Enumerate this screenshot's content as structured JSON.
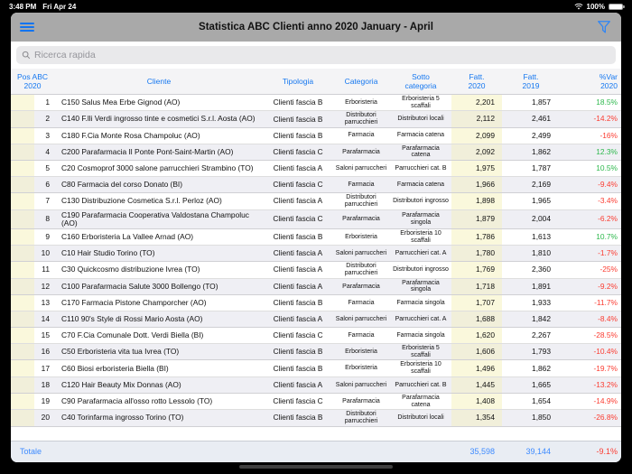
{
  "status_bar": {
    "time": "3:48 PM",
    "date": "Fri Apr 24",
    "battery": "100%"
  },
  "nav_bar": {
    "title": "Statistica ABC Clienti anno 2020 January - April"
  },
  "search": {
    "placeholder": "Ricerca rapida"
  },
  "icons": {
    "menu": "hamburger-menu-icon",
    "filter": "funnel-filter-icon",
    "search": "magnifier-icon",
    "wifi": "wifi-icon",
    "battery": "battery-icon"
  },
  "colors": {
    "accent_blue": "#1577f0",
    "positive_green": "#2db84c",
    "negative_red": "#fb3b30",
    "nav_gray": "#a9a9a9",
    "highlight_yellow": "#faf8dc",
    "row_alt_gray": "#efeff4",
    "totale_bg": "#e9edf3"
  },
  "table": {
    "columns": [
      "Pos ABC\n2020",
      "Cliente",
      "Tipologia",
      "Categoria",
      "Sotto\ncategoria",
      "Fatt.\n2020",
      "Fatt.\n2019",
      "%Var\n2020"
    ],
    "rows": [
      {
        "pos": "1",
        "cliente": "C150 Salus Mea Erbe  Gignod (AO)",
        "tipologia": "Clienti fascia B",
        "categoria": "Erboristeria",
        "sotto": "Erboristeria 5 scaffali",
        "f2020": "2,201",
        "f2019": "1,857",
        "var": "18.5%"
      },
      {
        "pos": "2",
        "cliente": "C140 F.lli Verdi ingrosso tinte e cosmetici S.r.l. Aosta (AO)",
        "tipologia": "Clienti fascia B",
        "categoria": "Distributori parrucchieri",
        "sotto": "Distributori locali",
        "f2020": "2,112",
        "f2019": "2,461",
        "var": "-14.2%"
      },
      {
        "pos": "3",
        "cliente": "C180 F.Cia Monte Rosa  Champoluc (AO)",
        "tipologia": "Clienti fascia B",
        "categoria": "Farmacia",
        "sotto": "Farmacia catena",
        "f2020": "2,099",
        "f2019": "2,499",
        "var": "-16%"
      },
      {
        "pos": "4",
        "cliente": "C200 Parafarmacia Il Ponte  Pont-Saint-Martin (AO)",
        "tipologia": "Clienti fascia C",
        "categoria": "Parafarmacia",
        "sotto": "Parafarmacia catena",
        "f2020": "2,092",
        "f2019": "1,862",
        "var": "12.3%"
      },
      {
        "pos": "5",
        "cliente": "C20 Cosmoprof 3000 salone parrucchieri Strambino (TO)",
        "tipologia": "Clienti fascia A",
        "categoria": "Saloni parruccheri",
        "sotto": "Parrucchieri cat. B",
        "f2020": "1,975",
        "f2019": "1,787",
        "var": "10.5%"
      },
      {
        "pos": "6",
        "cliente": "C80 Farmacia del corso  Donato (BI)",
        "tipologia": "Clienti fascia C",
        "categoria": "Farmacia",
        "sotto": "Farmacia catena",
        "f2020": "1,966",
        "f2019": "2,169",
        "var": "-9.4%"
      },
      {
        "pos": "7",
        "cliente": "C130 Distribuzione Cosmetica S.r.l.  Perloz (AO)",
        "tipologia": "Clienti fascia A",
        "categoria": "Distributori parrucchieri",
        "sotto": "Distributori ingrosso",
        "f2020": "1,898",
        "f2019": "1,965",
        "var": "-3.4%"
      },
      {
        "pos": "8",
        "cliente": "C190 Parafarmacia Cooperativa Valdostana Champoluc (AO)",
        "tipologia": "Clienti fascia C",
        "categoria": "Parafarmacia",
        "sotto": "Parafarmacia singola",
        "f2020": "1,879",
        "f2019": "2,004",
        "var": "-6.2%"
      },
      {
        "pos": "9",
        "cliente": "C160 Erboristeria La Vallee  Arnad (AO)",
        "tipologia": "Clienti fascia B",
        "categoria": "Erboristeria",
        "sotto": "Erboristeria 10 scaffali",
        "f2020": "1,786",
        "f2019": "1,613",
        "var": "10.7%"
      },
      {
        "pos": "10",
        "cliente": "C10 Hair Studio  Torino (TO)",
        "tipologia": "Clienti fascia A",
        "categoria": "Saloni parruccheri",
        "sotto": "Parrucchieri cat. A",
        "f2020": "1,780",
        "f2019": "1,810",
        "var": "-1.7%"
      },
      {
        "pos": "11",
        "cliente": "C30 Quickcosmo distribuzione  Ivrea (TO)",
        "tipologia": "Clienti fascia A",
        "categoria": "Distributori parrucchieri",
        "sotto": "Distributori ingrosso",
        "f2020": "1,769",
        "f2019": "2,360",
        "var": "-25%"
      },
      {
        "pos": "12",
        "cliente": "C100 Parafarmacia Salute 3000  Bollengo (TO)",
        "tipologia": "Clienti fascia A",
        "categoria": "Parafarmacia",
        "sotto": "Parafarmacia singola",
        "f2020": "1,718",
        "f2019": "1,891",
        "var": "-9.2%"
      },
      {
        "pos": "13",
        "cliente": "C170 Farmacia Pistone  Champorcher (AO)",
        "tipologia": "Clienti fascia B",
        "categoria": "Farmacia",
        "sotto": "Farmacia singola",
        "f2020": "1,707",
        "f2019": "1,933",
        "var": "-11.7%"
      },
      {
        "pos": "14",
        "cliente": "C110 90's Style di Rossi Mario  Aosta (AO)",
        "tipologia": "Clienti fascia A",
        "categoria": "Saloni parruccheri",
        "sotto": "Parrucchieri cat. A",
        "f2020": "1,688",
        "f2019": "1,842",
        "var": "-8.4%"
      },
      {
        "pos": "15",
        "cliente": "C70 F.Cia Comunale Dott. Verdi  Biella (BI)",
        "tipologia": "Clienti fascia C",
        "categoria": "Farmacia",
        "sotto": "Farmacia singola",
        "f2020": "1,620",
        "f2019": "2,267",
        "var": "-28.5%"
      },
      {
        "pos": "16",
        "cliente": "C50 Erboristeria vita tua  Ivrea (TO)",
        "tipologia": "Clienti fascia B",
        "categoria": "Erboristeria",
        "sotto": "Erboristeria 5 scaffali",
        "f2020": "1,606",
        "f2019": "1,793",
        "var": "-10.4%"
      },
      {
        "pos": "17",
        "cliente": "C60 Biosi erboristeria  Biella (BI)",
        "tipologia": "Clienti fascia B",
        "categoria": "Erboristeria",
        "sotto": "Erboristeria 10 scaffali",
        "f2020": "1,496",
        "f2019": "1,862",
        "var": "-19.7%"
      },
      {
        "pos": "18",
        "cliente": "C120 Hair Beauty Mix  Donnas (AO)",
        "tipologia": "Clienti fascia A",
        "categoria": "Saloni parruccheri",
        "sotto": "Parrucchieri cat. B",
        "f2020": "1,445",
        "f2019": "1,665",
        "var": "-13.2%"
      },
      {
        "pos": "19",
        "cliente": "C90 Parafarmacia all'osso rotto  Lessolo (TO)",
        "tipologia": "Clienti fascia C",
        "categoria": "Parafarmacia",
        "sotto": "Parafarmacia catena",
        "f2020": "1,408",
        "f2019": "1,654",
        "var": "-14.9%"
      },
      {
        "pos": "20",
        "cliente": "C40 Torinfarma ingrosso  Torino (TO)",
        "tipologia": "Clienti fascia B",
        "categoria": "Distributori parrucchieri",
        "sotto": "Distributori locali",
        "f2020": "1,354",
        "f2019": "1,850",
        "var": "-26.8%"
      }
    ],
    "totale": {
      "label": "Totale",
      "f2020": "35,598",
      "f2019": "39,144",
      "var": "-9.1%"
    }
  }
}
